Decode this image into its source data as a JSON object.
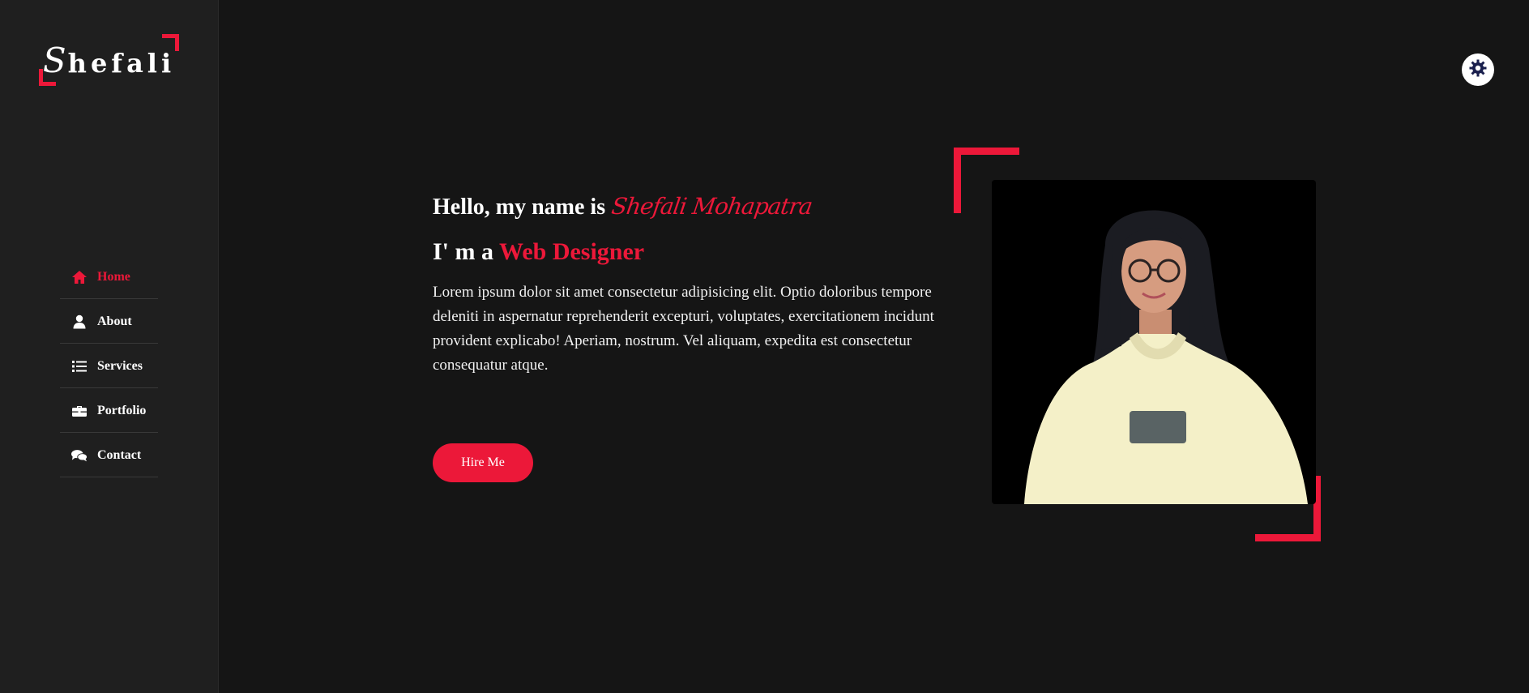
{
  "logo": {
    "first_letter": "S",
    "rest": "hefali"
  },
  "nav": {
    "items": [
      {
        "label": "Home",
        "icon": "home-icon",
        "active": true
      },
      {
        "label": "About",
        "icon": "user-icon",
        "active": false
      },
      {
        "label": "Services",
        "icon": "list-icon",
        "active": false
      },
      {
        "label": "Portfolio",
        "icon": "briefcase-icon",
        "active": false
      },
      {
        "label": "Contact",
        "icon": "comments-icon",
        "active": false
      }
    ]
  },
  "hero": {
    "greeting": "Hello, my name is",
    "name": "Shefali Mohapatra",
    "role_prefix": "I' m a",
    "role": "Web Designer",
    "description": "Lorem ipsum dolor sit amet consectetur adipisicing elit. Optio doloribus tempore deleniti in aspernatur reprehenderit excepturi, voluptates, exercitationem incidunt provident explicabo! Aperiam, nostrum. Vel aliquam, expedita est consectetur consequatur atque.",
    "cta": "Hire Me"
  },
  "theme_toggle": {
    "icon": "gear-icon"
  },
  "colors": {
    "accent": "#ec1839",
    "background": "#151515",
    "sidebar": "#1f1f1f",
    "text": "#ffffff"
  }
}
